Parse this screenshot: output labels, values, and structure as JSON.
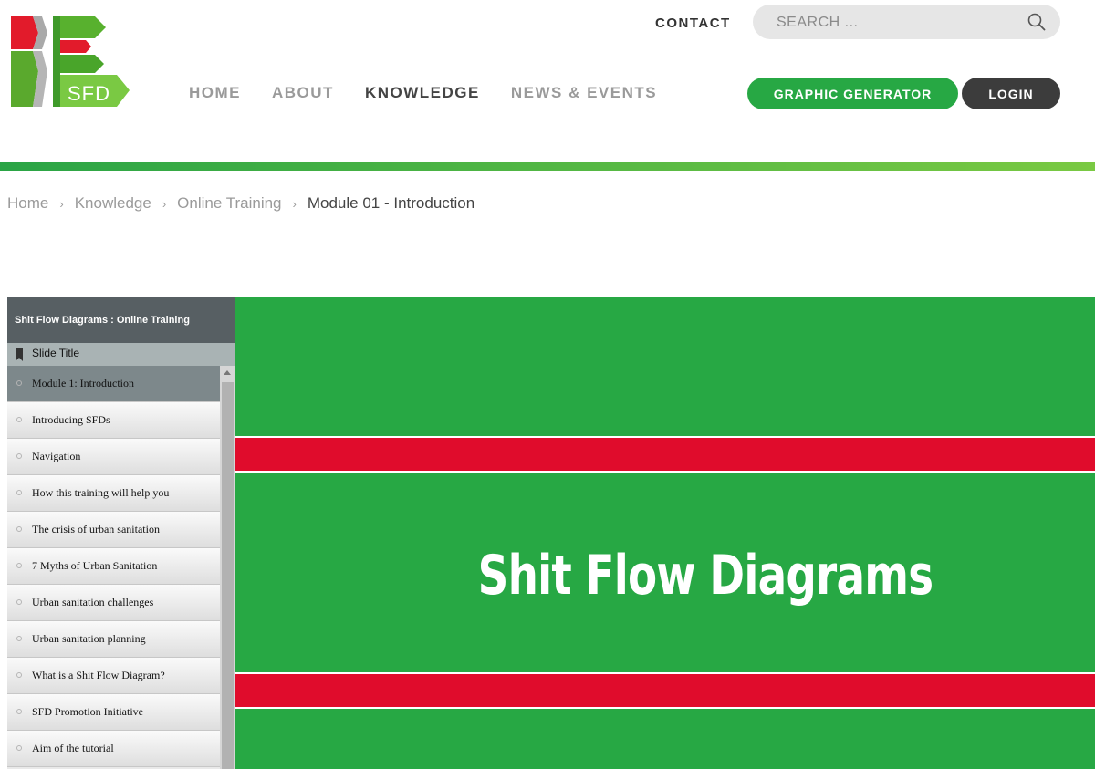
{
  "header": {
    "logo_text": "SFD",
    "contact_label": "CONTACT",
    "search_placeholder": "SEARCH ...",
    "nav": [
      {
        "label": "HOME",
        "active": false
      },
      {
        "label": "ABOUT",
        "active": false
      },
      {
        "label": "KNOWLEDGE",
        "active": true
      },
      {
        "label": "NEWS & EVENTS",
        "active": false
      }
    ],
    "graphic_button": "GRAPHIC GENERATOR",
    "login_button": "LOGIN"
  },
  "breadcrumb": {
    "items": [
      "Home",
      "Knowledge",
      "Online Training"
    ],
    "current": "Module 01 - Introduction",
    "separator": "›"
  },
  "player": {
    "title": "Shit Flow Diagrams : Online Training",
    "column_header": "Slide Title",
    "slides": [
      {
        "label": "Module 1: Introduction",
        "active": true
      },
      {
        "label": "Introducing SFDs",
        "active": false
      },
      {
        "label": "Navigation",
        "active": false
      },
      {
        "label": "How this training will help you",
        "active": false
      },
      {
        "label": "The crisis of urban sanitation",
        "active": false
      },
      {
        "label": "7 Myths of Urban Sanitation",
        "active": false
      },
      {
        "label": "Urban sanitation challenges",
        "active": false
      },
      {
        "label": "Urban sanitation planning",
        "active": false
      },
      {
        "label": "What is a Shit Flow Diagram?",
        "active": false
      },
      {
        "label": "SFD Promotion Initiative",
        "active": false
      },
      {
        "label": "Aim of the tutorial",
        "active": false
      }
    ]
  },
  "slide": {
    "title": "Shit Flow Diagrams"
  },
  "colors": {
    "brand_green": "#27a844",
    "brand_red": "#e00c2c",
    "dark_button": "#3c3c3c"
  }
}
